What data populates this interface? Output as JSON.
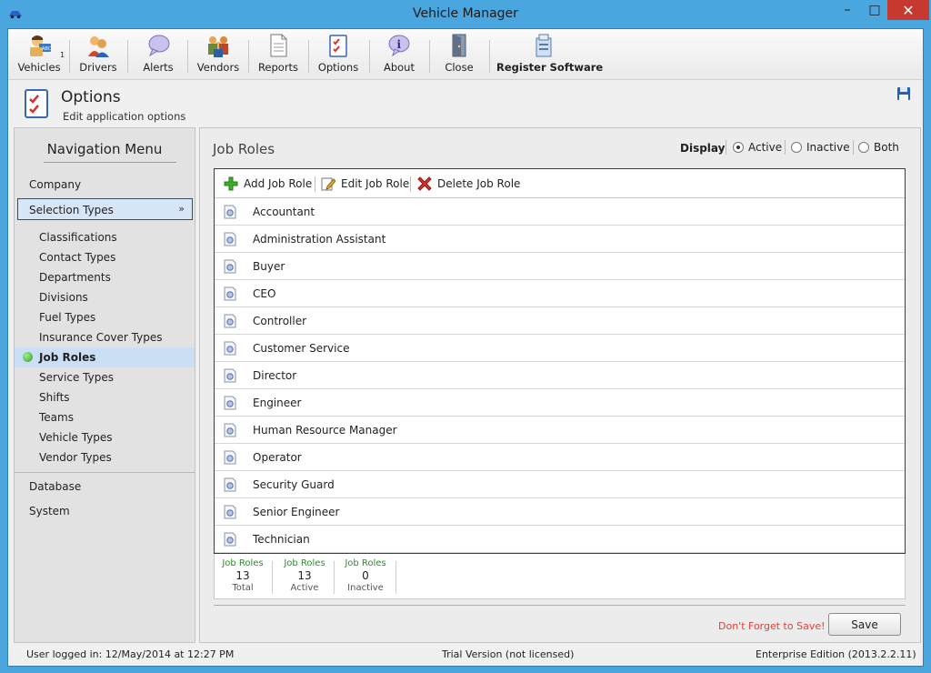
{
  "window": {
    "title": "Vehicle Manager",
    "minimize": "–",
    "maximize": "□",
    "close": "✕"
  },
  "toolbar": {
    "vehicles": "Vehicles",
    "vehicles_badge": "1",
    "drivers": "Drivers",
    "alerts": "Alerts",
    "vendors": "Vendors",
    "reports": "Reports",
    "options": "Options",
    "about": "About",
    "close": "Close",
    "register": "Register Software"
  },
  "header": {
    "title": "Options",
    "subtitle": "Edit application options"
  },
  "nav": {
    "title": "Navigation Menu",
    "company": "Company",
    "selection_types": "Selection Types",
    "items": [
      "Classifications",
      "Contact Types",
      "Departments",
      "Divisions",
      "Fuel Types",
      "Insurance Cover Types",
      "Job Roles",
      "Service Types",
      "Shifts",
      "Teams",
      "Vehicle Types",
      "Vendor Types"
    ],
    "database": "Database",
    "system": "System"
  },
  "main": {
    "title": "Job Roles",
    "display_label": "Display",
    "display_options": [
      "Active",
      "Inactive",
      "Both"
    ],
    "display_selected": "Active",
    "actions": {
      "add": "Add Job Role",
      "edit": "Edit Job Role",
      "delete": "Delete Job Role"
    },
    "rows": [
      "Accountant",
      "Administration Assistant",
      "Buyer",
      "CEO",
      "Controller",
      "Customer Service",
      "Director",
      "Engineer",
      "Human Resource Manager",
      "Operator",
      "Security Guard",
      "Senior Engineer",
      "Technician"
    ],
    "stats": [
      {
        "label": "Job Roles",
        "value": "13",
        "caption": "Total"
      },
      {
        "label": "Job Roles",
        "value": "13",
        "caption": "Active"
      },
      {
        "label": "Job Roles",
        "value": "0",
        "caption": "Inactive"
      }
    ],
    "reminder": "Don't Forget to Save!",
    "save": "Save"
  },
  "status": {
    "user": "User logged in:  12/May/2014 at 12:27 PM",
    "license": "Trial Version (not licensed)",
    "edition": "Enterprise Edition (2013.2.2.11)"
  },
  "colors": {
    "titlebar": "#4aa6de",
    "close": "#c7392f",
    "selected_nav": "#cbdff4",
    "stat_label": "#2e8a2e",
    "reminder": "#e0403a"
  }
}
